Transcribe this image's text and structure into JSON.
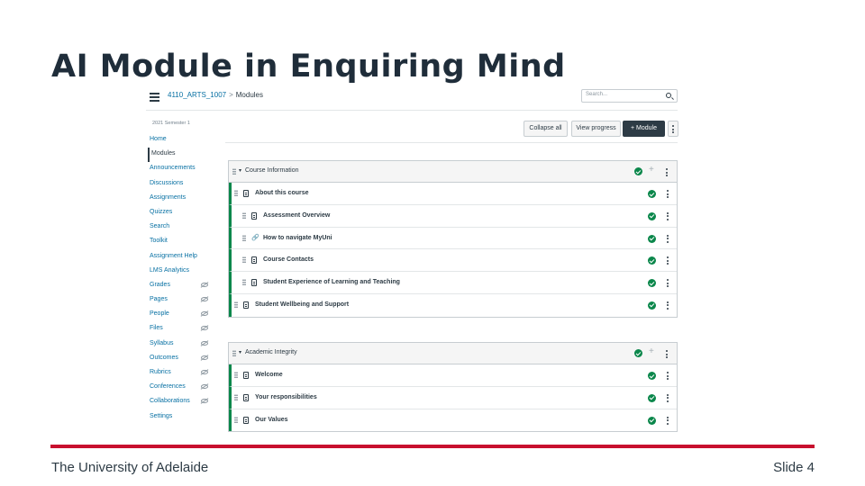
{
  "slide": {
    "title": "AI Module in Enquiring Mind",
    "footer_left": "The University of Adelaide",
    "footer_right": "Slide 4",
    "accent_color": "#c8102e"
  },
  "lms": {
    "breadcrumb": {
      "course": "4110_ARTS_1007",
      "separator": ">",
      "current": "Modules"
    },
    "search": {
      "placeholder": "Search..."
    },
    "term": "2021 Semester 1",
    "nav": [
      {
        "label": "Home",
        "hidden": false,
        "active": false
      },
      {
        "label": "Modules",
        "hidden": false,
        "active": true
      },
      {
        "label": "Announcements",
        "hidden": false,
        "active": false
      },
      {
        "label": "Discussions",
        "hidden": false,
        "active": false
      },
      {
        "label": "Assignments",
        "hidden": false,
        "active": false
      },
      {
        "label": "Quizzes",
        "hidden": false,
        "active": false
      },
      {
        "label": "Search",
        "hidden": false,
        "active": false
      },
      {
        "label": "Toolkit",
        "hidden": false,
        "active": false
      },
      {
        "label": "Assignment Help",
        "hidden": false,
        "active": false
      },
      {
        "label": "LMS Analytics",
        "hidden": false,
        "active": false
      },
      {
        "label": "Grades",
        "hidden": true,
        "active": false
      },
      {
        "label": "Pages",
        "hidden": true,
        "active": false
      },
      {
        "label": "People",
        "hidden": true,
        "active": false
      },
      {
        "label": "Files",
        "hidden": true,
        "active": false
      },
      {
        "label": "Syllabus",
        "hidden": true,
        "active": false
      },
      {
        "label": "Outcomes",
        "hidden": true,
        "active": false
      },
      {
        "label": "Rubrics",
        "hidden": true,
        "active": false
      },
      {
        "label": "Conferences",
        "hidden": true,
        "active": false
      },
      {
        "label": "Collaborations",
        "hidden": true,
        "active": false
      },
      {
        "label": "Settings",
        "hidden": false,
        "active": false
      }
    ],
    "buttons": {
      "collapse_all": "Collapse all",
      "view_progress": "View progress",
      "add_module": "+ Module"
    },
    "modules": [
      {
        "title": "Course Information",
        "items": [
          {
            "label": "About this course",
            "icon": "page-icon",
            "indent": 0
          },
          {
            "label": "Assessment Overview",
            "icon": "page-icon",
            "indent": 1
          },
          {
            "label": "How to navigate MyUni",
            "icon": "link-icon",
            "indent": 1
          },
          {
            "label": "Course Contacts",
            "icon": "page-icon",
            "indent": 1
          },
          {
            "label": "Student Experience of Learning and Teaching",
            "icon": "page-icon",
            "indent": 1
          },
          {
            "label": "Student Wellbeing and Support",
            "icon": "page-icon",
            "indent": 0
          }
        ]
      },
      {
        "title": "Academic Integrity",
        "items": [
          {
            "label": "Welcome",
            "icon": "page-icon",
            "indent": 0
          },
          {
            "label": "Your responsibilities",
            "icon": "page-icon",
            "indent": 0
          },
          {
            "label": "Our Values",
            "icon": "page-icon",
            "indent": 0
          }
        ]
      }
    ]
  }
}
